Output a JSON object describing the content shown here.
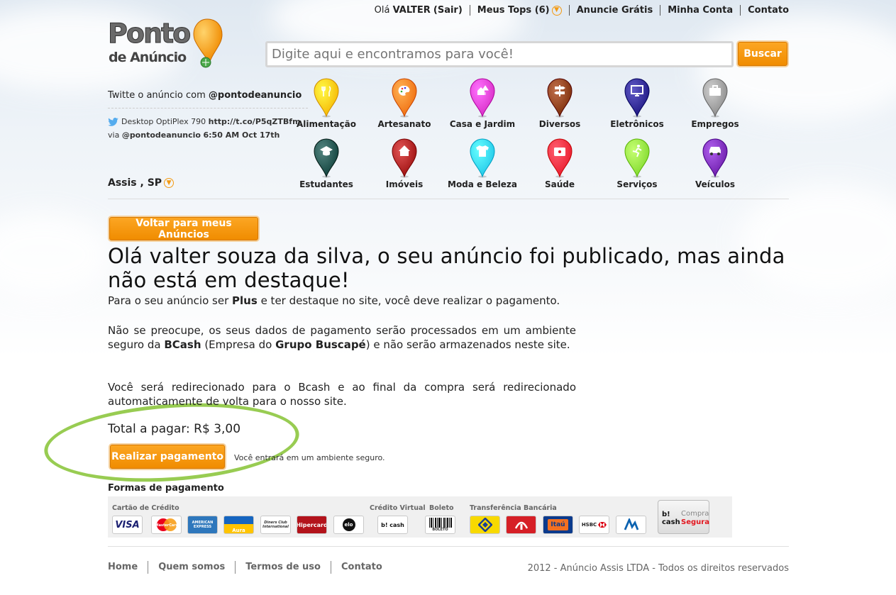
{
  "header": {
    "greeting_prefix": "Olá",
    "user_name": "VALTER",
    "logout": "(Sair)",
    "my_tops": "Meus Tops (6)",
    "announce_free": "Anuncie Grátis",
    "my_account": "Minha Conta",
    "contact": "Contato"
  },
  "logo": {
    "line1": "Ponto",
    "line2": "de Anúncio"
  },
  "search": {
    "placeholder": "Digite aqui e encontramos para você!",
    "button": "Buscar"
  },
  "twitter": {
    "share_prefix": "Twitte o anúncio com",
    "share_handle": "@pontodeanuncio",
    "tweet_text": "Desktop OptiPlex 790",
    "tweet_link": "http://t.co/P5qZTBfm",
    "via": "via",
    "via_handle": "@pontodeanuncio",
    "time": "6:50 AM Oct 17th"
  },
  "location": "Assis , SP",
  "categories": [
    {
      "label": "Alimentação",
      "color": "#f5b400",
      "icon": "cutlery-icon"
    },
    {
      "label": "Artesanato",
      "color": "#ef6c0e",
      "icon": "palette-icon"
    },
    {
      "label": "Casa e Jardim",
      "color": "#d62cc4",
      "icon": "house-tree-icon"
    },
    {
      "label": "Diversos",
      "color": "#7a2a06",
      "icon": "signpost-icon"
    },
    {
      "label": "Eletrônicos",
      "color": "#1b1480",
      "icon": "monitor-icon"
    },
    {
      "label": "Empregos",
      "color": "#8a8a8a",
      "icon": "briefcase-icon"
    },
    {
      "label": "Estudantes",
      "color": "#0e3f3a",
      "icon": "graduation-cap-icon"
    },
    {
      "label": "Imóveis",
      "color": "#9b0e0e",
      "icon": "home-icon"
    },
    {
      "label": "Moda e Beleza",
      "color": "#20c6e8",
      "icon": "shirt-icon"
    },
    {
      "label": "Saúde",
      "color": "#e8192a",
      "icon": "first-aid-icon"
    },
    {
      "label": "Serviços",
      "color": "#7fd82c",
      "icon": "runner-icon"
    },
    {
      "label": "Veículos",
      "color": "#6a1aa8",
      "icon": "car-icon"
    }
  ],
  "main": {
    "back_button": "Voltar para meus Anúncios",
    "headline": "Olá valter souza da silva, o seu anúncio foi publicado, mas ainda não está em destaque!",
    "p1_a": "Para o seu anúncio ser",
    "p1_b": "Plus",
    "p1_c": "e ter destaque no site, você deve realizar o pagamento.",
    "p2_a": "Não se preocupe, os seus dados de pagamento serão processados em um ambiente seguro da",
    "p2_b": "BCash",
    "p2_c": "(Empresa do",
    "p2_d": "Grupo Buscapé",
    "p2_e": ") e não serão armazenados neste site.",
    "p3": "Você será redirecionado para o Bcash e ao final da compra será redirecionado automaticamente de volta para o nosso site.",
    "total_label": "Total a pagar:",
    "total_value": "R$ 3,00",
    "pay_button": "Realizar pagamento",
    "secure_note": "Você entrará em um ambiente seguro."
  },
  "payment": {
    "title": "Formas de pagamento",
    "groups": {
      "credit": "Cartão de Crédito",
      "virtual": "Crédito Virtual",
      "boleto": "Boleto",
      "transfer": "Transferência Bancária"
    },
    "cards": [
      "VISA",
      "MasterCard",
      "AMERICAN EXPRESS",
      "Aura",
      "Diners Club International",
      "Hipercard",
      "elo"
    ],
    "virtual": [
      "b! cash"
    ],
    "boleto": [
      "BOLETO"
    ],
    "banks": [
      "Banco do Brasil",
      "Bradesco",
      "Itaú",
      "HSBC",
      "Banrisul"
    ],
    "bcash_badge": {
      "brand": "b! cash",
      "line1": "Compra",
      "line2": "Segura"
    }
  },
  "footer": {
    "links": [
      "Home",
      "Quem somos",
      "Termos de uso",
      "Contato"
    ],
    "copyright": "2012 - Anúncio Assis LTDA - Todos os direitos reservados"
  }
}
